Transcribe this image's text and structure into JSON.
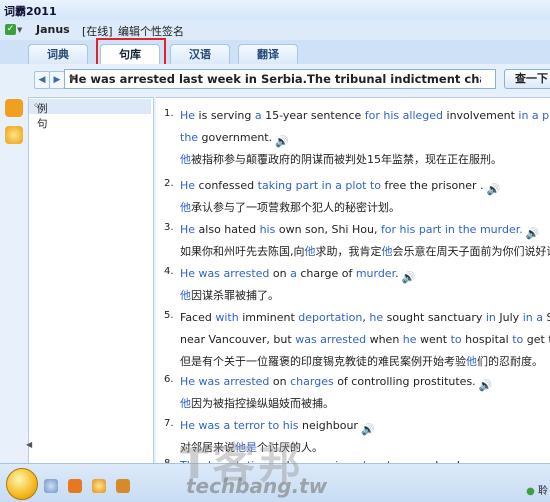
{
  "window": {
    "title": "词霸2011"
  },
  "user": {
    "name": "Janus",
    "status": "[在线]",
    "signature": "编辑个性签名"
  },
  "tabs": [
    {
      "label": "词典"
    },
    {
      "label": "句库"
    },
    {
      "label": "汉语"
    },
    {
      "label": "翻译"
    }
  ],
  "search": {
    "query": "He was arrested last week in Serbia.The tribunal indictment charges h",
    "button": "查一下"
  },
  "sidebar": {
    "items": [
      {
        "label": "例句"
      }
    ]
  },
  "sentences": [
    {
      "num": "1.",
      "en": [
        {
          "t": "He",
          "h": true
        },
        {
          "t": " is serving ",
          "h": false
        },
        {
          "t": "a",
          "h": true
        },
        {
          "t": " 15-year sentence ",
          "h": false
        },
        {
          "t": "for his alleged",
          "h": true
        },
        {
          "t": " involvement ",
          "h": false
        },
        {
          "t": "in a plot to",
          "h": true
        },
        {
          "t": " over",
          "h": false
        }
      ],
      "en2": [
        {
          "t": "the",
          "h": true
        },
        {
          "t": " government.",
          "h": false
        }
      ],
      "cn": [
        {
          "t": "他",
          "h": true
        },
        {
          "t": "被指称参与颠覆政府的阴谋而被判处15年监禁，现在正在服刑。",
          "h": false
        }
      ]
    },
    {
      "num": "2.",
      "en": [
        {
          "t": "He",
          "h": true
        },
        {
          "t": " confessed ",
          "h": false
        },
        {
          "t": "taking part in a plot to",
          "h": true
        },
        {
          "t": " free the ",
          "h": false
        },
        {
          "t": "prisoner",
          "h": false
        },
        {
          "t": " .",
          "h": false
        }
      ],
      "cn": [
        {
          "t": "他",
          "h": true
        },
        {
          "t": "承认参与了一项营救那个犯人的秘密计划。",
          "h": false
        }
      ]
    },
    {
      "num": "3.",
      "en": [
        {
          "t": "He",
          "h": true
        },
        {
          "t": " also hated ",
          "h": false
        },
        {
          "t": "his",
          "h": true
        },
        {
          "t": " own son, Shi Hou, ",
          "h": false
        },
        {
          "t": "for his part in the murder.",
          "h": true
        }
      ],
      "cn": [
        {
          "t": "如果你和州吁先去陈国,向",
          "h": false
        },
        {
          "t": "他",
          "h": true
        },
        {
          "t": "求助，我肯定",
          "h": false
        },
        {
          "t": "他",
          "h": true
        },
        {
          "t": "会乐意在周天子面前为你们说好话",
          "h": false
        }
      ]
    },
    {
      "num": "4.",
      "en": [
        {
          "t": "He was arrested",
          "h": true
        },
        {
          "t": " on ",
          "h": false
        },
        {
          "t": "a",
          "h": true
        },
        {
          "t": " charge of ",
          "h": false
        },
        {
          "t": "murder",
          "h": true
        },
        {
          "t": ".",
          "h": false
        }
      ],
      "cn": [
        {
          "t": "他",
          "h": true
        },
        {
          "t": "因谋杀罪被捕了。",
          "h": false
        }
      ]
    },
    {
      "num": "5.",
      "en": [
        {
          "t": "Faced ",
          "h": false
        },
        {
          "t": "with",
          "h": true
        },
        {
          "t": " imminent ",
          "h": false
        },
        {
          "t": "deportation",
          "h": true
        },
        {
          "t": ", ",
          "h": false
        },
        {
          "t": "he",
          "h": true
        },
        {
          "t": " sought sanctuary ",
          "h": false
        },
        {
          "t": "in",
          "h": true
        },
        {
          "t": " July ",
          "h": false
        },
        {
          "t": "in a",
          "h": true
        },
        {
          "t": " Sikh temp",
          "h": false
        }
      ],
      "en2": [
        {
          "t": "near Vancouver, but ",
          "h": false
        },
        {
          "t": "was arrested",
          "h": true
        },
        {
          "t": " when ",
          "h": false
        },
        {
          "t": "he",
          "h": true
        },
        {
          "t": " went ",
          "h": false
        },
        {
          "t": "to",
          "h": true
        },
        {
          "t": " hospital ",
          "h": false
        },
        {
          "t": "to",
          "h": true
        },
        {
          "t": " get treatment",
          "h": false
        }
      ],
      "cn": [
        {
          "t": "但是有个关于一位羅褒的印度锡克教徒的难民案例开始考验",
          "h": false
        },
        {
          "t": "他",
          "h": true
        },
        {
          "t": "们的忍耐度。",
          "h": false
        }
      ]
    },
    {
      "num": "6.",
      "en": [
        {
          "t": "He was arrested",
          "h": true
        },
        {
          "t": " on ",
          "h": false
        },
        {
          "t": "charges",
          "h": true
        },
        {
          "t": " of controlling prostitutes.",
          "h": false
        }
      ],
      "cn": [
        {
          "t": "他",
          "h": true
        },
        {
          "t": "因为被指控操纵娼妓而被捕。",
          "h": false
        }
      ]
    },
    {
      "num": "7.",
      "en": [
        {
          "t": "He was a terror to his",
          "h": true
        },
        {
          "t": " neighbour",
          "h": false
        }
      ],
      "cn": [
        {
          "t": "对邻居来说",
          "h": false
        },
        {
          "t": "他是",
          "h": true
        },
        {
          "t": "个讨厌的人。",
          "h": false
        }
      ]
    },
    {
      "num": "8.",
      "en": [
        {
          "t": "The deportation ",
          "h": true
        },
        {
          "t": "order ",
          "h": false
        },
        {
          "t": "was signed and",
          "h": true
        },
        {
          "t": " removal orders",
          "h": false
        }
      ],
      "cn": []
    }
  ],
  "watermark": {
    "logo": "T客邦",
    "site": "techbang.tw"
  },
  "corner_label": "聆",
  "colors": {
    "highlight": "#2f63c8",
    "accent_red": "#e0232a"
  }
}
